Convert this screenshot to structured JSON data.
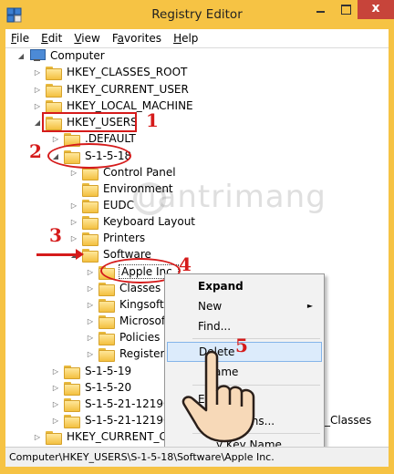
{
  "window": {
    "title": "Registry Editor",
    "close_glyph": "x"
  },
  "menubar": {
    "items": [
      {
        "label": "File",
        "mnemonic": "F",
        "rest": "ile"
      },
      {
        "label": "Edit",
        "mnemonic": "E",
        "rest": "dit"
      },
      {
        "label": "View",
        "mnemonic": "V",
        "rest": "iew"
      },
      {
        "label": "Favorites",
        "mnemonic": "a",
        "pre": "F",
        "rest": "vorites"
      },
      {
        "label": "Help",
        "mnemonic": "H",
        "rest": "elp"
      }
    ]
  },
  "tree": {
    "computer": "Computer",
    "hkcr": "HKEY_CLASSES_ROOT",
    "hkcu": "HKEY_CURRENT_USER",
    "hklm": "HKEY_LOCAL_MACHINE",
    "hku": "HKEY_USERS",
    "default": ".DEFAULT",
    "s1518": "S-1-5-18",
    "control_panel": "Control Panel",
    "environment": "Environment",
    "eudc": "EUDC",
    "keyboard_layout": "Keyboard Layout",
    "printers": "Printers",
    "software": "Software",
    "apple": "Apple Inc.",
    "classes": "Classes",
    "kingsoft": "Kingsoft",
    "microsoft": "Microsoft",
    "policies": "Policies",
    "registered": "Registered",
    "s1519": "S-1-5-19",
    "s1520": "S-1-5-20",
    "s15211a": "S-1-5-21-1219074",
    "s15211b": "S-1-5-21-1219074",
    "hkcc": "HKEY_CURRENT_CO",
    "classes_suffix": "_Classes"
  },
  "context_menu": {
    "expand": "Expand",
    "new": "New",
    "find": "Find...",
    "delete": "Delete",
    "rename_partial": "ame",
    "export_partial": "E",
    "permissions_partial": "...ons...",
    "copy_key_name_partial": "y Key Name"
  },
  "annotations": {
    "n1": "1",
    "n2": "2",
    "n3": "3",
    "n4": "4",
    "n5": "5",
    "color": "#d51b1b"
  },
  "watermark": {
    "text": "uantrimang"
  },
  "statusbar": {
    "path": "Computer\\HKEY_USERS\\S-1-5-18\\Software\\Apple Inc."
  },
  "colors": {
    "frame": "#f6c344",
    "close_button": "#c7443a",
    "menu_hover": "#dcebfb"
  }
}
